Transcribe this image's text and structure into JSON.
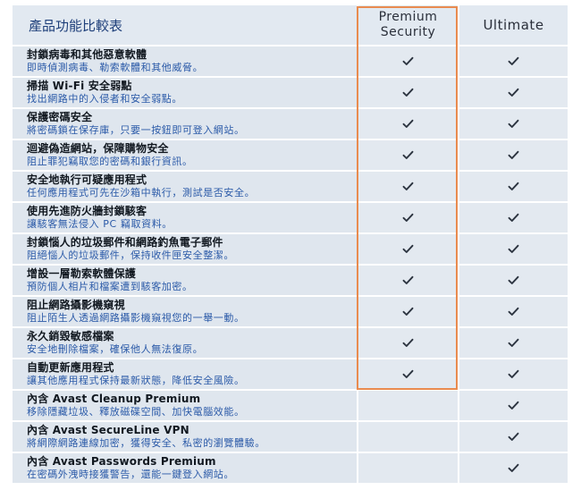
{
  "table": {
    "title": "產品功能比較表",
    "plans": [
      {
        "name_line1": "Premium",
        "name_line2": "Security"
      },
      {
        "name": "Ultimate"
      }
    ],
    "check_icon": "check-icon",
    "highlight_color": "#e98b4f",
    "rows": [
      {
        "title": "封鎖病毒和其他惡意軟體",
        "desc": "即時偵測病毒、勒索軟體和其他威脅。",
        "premium": "✓",
        "ultimate": "✓"
      },
      {
        "title": "掃描 Wi-Fi 安全弱點",
        "desc": "找出網路中的入侵者和安全弱點。",
        "premium": "✓",
        "ultimate": "✓"
      },
      {
        "title": "保護密碼安全",
        "desc": "將密碼鎖在保存庫，只要一按鈕即可登入網站。",
        "premium": "✓",
        "ultimate": "✓"
      },
      {
        "title": "迴避偽造網站，保障購物安全",
        "desc": "阻止罪犯竊取您的密碼和銀行資訊。",
        "premium": "✓",
        "ultimate": "✓"
      },
      {
        "title": "安全地執行可疑應用程式",
        "desc": "任何應用程式可先在沙箱中執行，測試是否安全。",
        "premium": "✓",
        "ultimate": "✓"
      },
      {
        "title": "使用先進防火牆封鎖駭客",
        "desc": "讓駭客無法侵入 PC 竊取資料。",
        "premium": "✓",
        "ultimate": "✓"
      },
      {
        "title": "封鎖惱人的垃圾郵件和網路釣魚電子郵件",
        "desc": "阻絕惱人的垃圾郵件，保持收件匣安全整潔。",
        "premium": "✓",
        "ultimate": "✓"
      },
      {
        "title": "增設一層勒索軟體保護",
        "desc": "預防個人相片和檔案遭到駭客加密。",
        "premium": "✓",
        "ultimate": "✓"
      },
      {
        "title": "阻止網路攝影機窺視",
        "desc": "阻止陌生人透過網路攝影機窺視您的一舉一動。",
        "premium": "✓",
        "ultimate": "✓"
      },
      {
        "title": "永久銷毀敏感檔案",
        "desc": "安全地刪除檔案，確保他人無法復原。",
        "premium": "✓",
        "ultimate": "✓"
      },
      {
        "title": "自動更新應用程式",
        "desc": "讓其他應用程式保持最新狀態，降低安全風險。",
        "premium": "✓",
        "ultimate": "✓"
      },
      {
        "title": "內含 Avast Cleanup Premium",
        "desc": "移除隱藏垃圾、釋放磁碟空間、加快電腦效能。",
        "premium": "",
        "ultimate": "✓"
      },
      {
        "title": "內含 Avast SecureLine VPN",
        "desc": "將網際網路連線加密，獲得安全、私密的瀏覽體驗。",
        "premium": "",
        "ultimate": "✓"
      },
      {
        "title": "內含 Avast Passwords Premium",
        "desc": "在密碼外洩時接獲警告，還能一鍵登入網站。",
        "premium": "",
        "ultimate": "✓"
      }
    ]
  }
}
